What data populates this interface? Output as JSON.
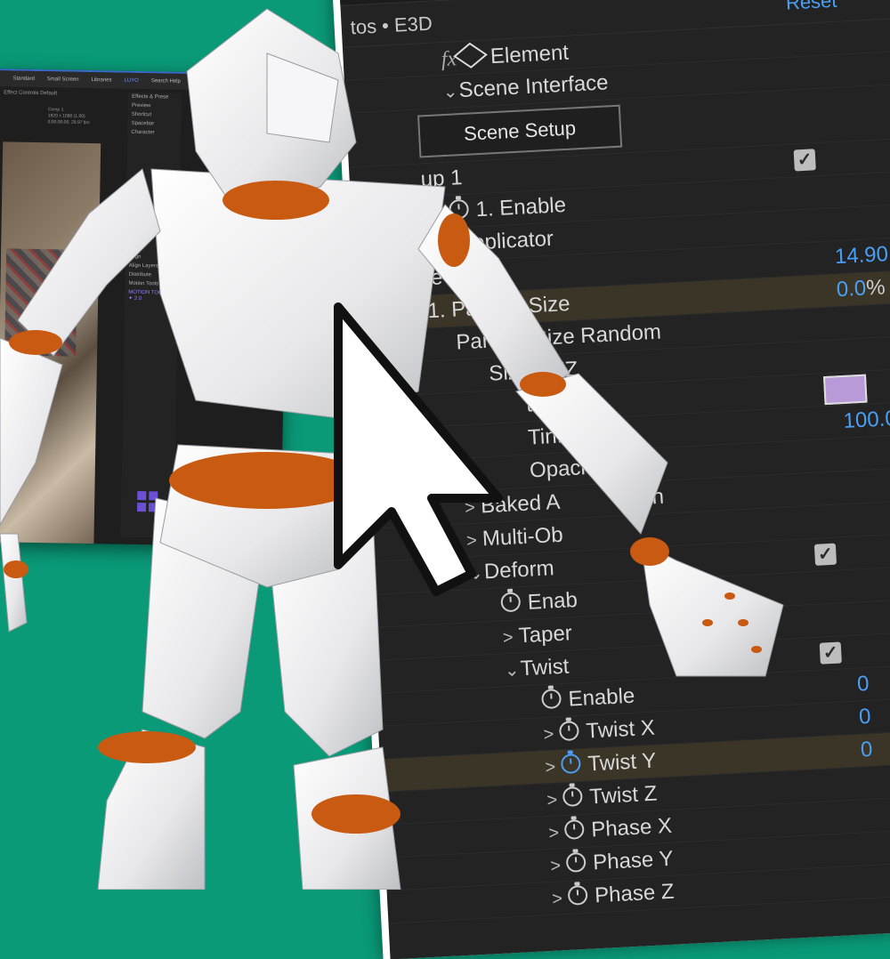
{
  "background_window": {
    "tabs": [
      "Standard",
      "Small Screen",
      "Libraries",
      "LUYO"
    ],
    "active_tab": "LUYO",
    "search_placeholder": "Search Help",
    "panel_title": "Effect Controls Default",
    "effects_label": "Effects & Prese",
    "preview_label": "Preview",
    "shortcut_label": "Shortcut",
    "shortcut_value": "Spacebar",
    "character_label": "Character",
    "comp_name": "Comp 1",
    "comp_info_1": "1920 x 1080 (1.00)",
    "comp_info_2": "0;00;00;00, 29.97 fps",
    "align_label": "Align",
    "align_layers_label": "Align Layers",
    "distribute_label": "Distribute",
    "motion_tools_label": "Motion Tools",
    "motion_tools_brand": "MOTION TOOLS ✦ 2.0"
  },
  "panel": {
    "title": "tos • E3D",
    "reset_label": "Reset",
    "accent_color": "#4a9ff5",
    "rows": [
      {
        "id": "element",
        "label": "Element",
        "indent": 1,
        "chevron": "",
        "icon": "fx-cube"
      },
      {
        "id": "scene-interface",
        "label": "Scene Interface",
        "indent": 1,
        "chevron": "⌄"
      },
      {
        "id": "scene-setup",
        "button": "Scene Setup"
      },
      {
        "id": "group1",
        "label": "up 1",
        "indent": 0,
        "checkbox": true
      },
      {
        "id": "enable1",
        "label": "1. Enable",
        "indent": 1,
        "stopwatch": true
      },
      {
        "id": "particle-replicator",
        "label": "cle Replicator",
        "indent": 0
      },
      {
        "id": "particle-look",
        "label": "le Look",
        "indent": 0,
        "value": "14.90"
      },
      {
        "id": "particle-size",
        "label": "1. Particle Size",
        "indent": 0,
        "value": "0.0",
        "value_suffix": "%",
        "highlight": true
      },
      {
        "id": "particle-size-random",
        "label": "Particle Size Random",
        "indent": 1
      },
      {
        "id": "size-xyz",
        "label": "Size XYZ",
        "indent": 2
      },
      {
        "id": "rotation",
        "label": "tation",
        "indent": 3,
        "swatch": true
      },
      {
        "id": "tint",
        "label": "Tint",
        "indent": 3,
        "value": "100.0"
      },
      {
        "id": "opacity",
        "label": "Opacity",
        "indent": 3
      },
      {
        "id": "baked-animation",
        "label": "Baked A",
        "tail": "on",
        "indent": 1,
        "chevron": ">"
      },
      {
        "id": "multi-object",
        "label": "Multi-Ob",
        "indent": 1,
        "chevron": ">"
      },
      {
        "id": "deform",
        "label": "Deform",
        "indent": 1,
        "chevron": "⌄",
        "checkbox": true
      },
      {
        "id": "deform-enable",
        "label": "Enab",
        "indent": 2,
        "stopwatch": true
      },
      {
        "id": "taper",
        "label": "Taper",
        "indent": 2,
        "chevron": ">"
      },
      {
        "id": "twist",
        "label": "Twist",
        "indent": 2,
        "chevron": "⌄",
        "checkbox": true
      },
      {
        "id": "twist-enable",
        "label": "Enable",
        "indent": 3,
        "stopwatch": true,
        "value": "0"
      },
      {
        "id": "twist-x",
        "label": "Twist X",
        "indent": 3,
        "chevron": ">",
        "stopwatch": true,
        "value": "0"
      },
      {
        "id": "twist-y",
        "label": "Twist Y",
        "indent": 3,
        "chevron": ">",
        "stopwatch": true,
        "active": true,
        "highlight": true,
        "value": "0"
      },
      {
        "id": "twist-z",
        "label": "Twist Z",
        "indent": 3,
        "chevron": ">",
        "stopwatch": true
      },
      {
        "id": "phase-x",
        "label": "Phase X",
        "indent": 3,
        "chevron": ">",
        "stopwatch": true
      },
      {
        "id": "phase-y",
        "label": "Phase Y",
        "indent": 3,
        "chevron": ">",
        "stopwatch": true
      },
      {
        "id": "phase-z",
        "label": "Phase Z",
        "indent": 3,
        "chevron": ">",
        "stopwatch": true
      }
    ]
  },
  "colors": {
    "background_green": "#0a9a78",
    "mannequin_white": "#f2f2f2",
    "mannequin_orange": "#c85a12",
    "swatch_purple": "#b89ad9"
  }
}
